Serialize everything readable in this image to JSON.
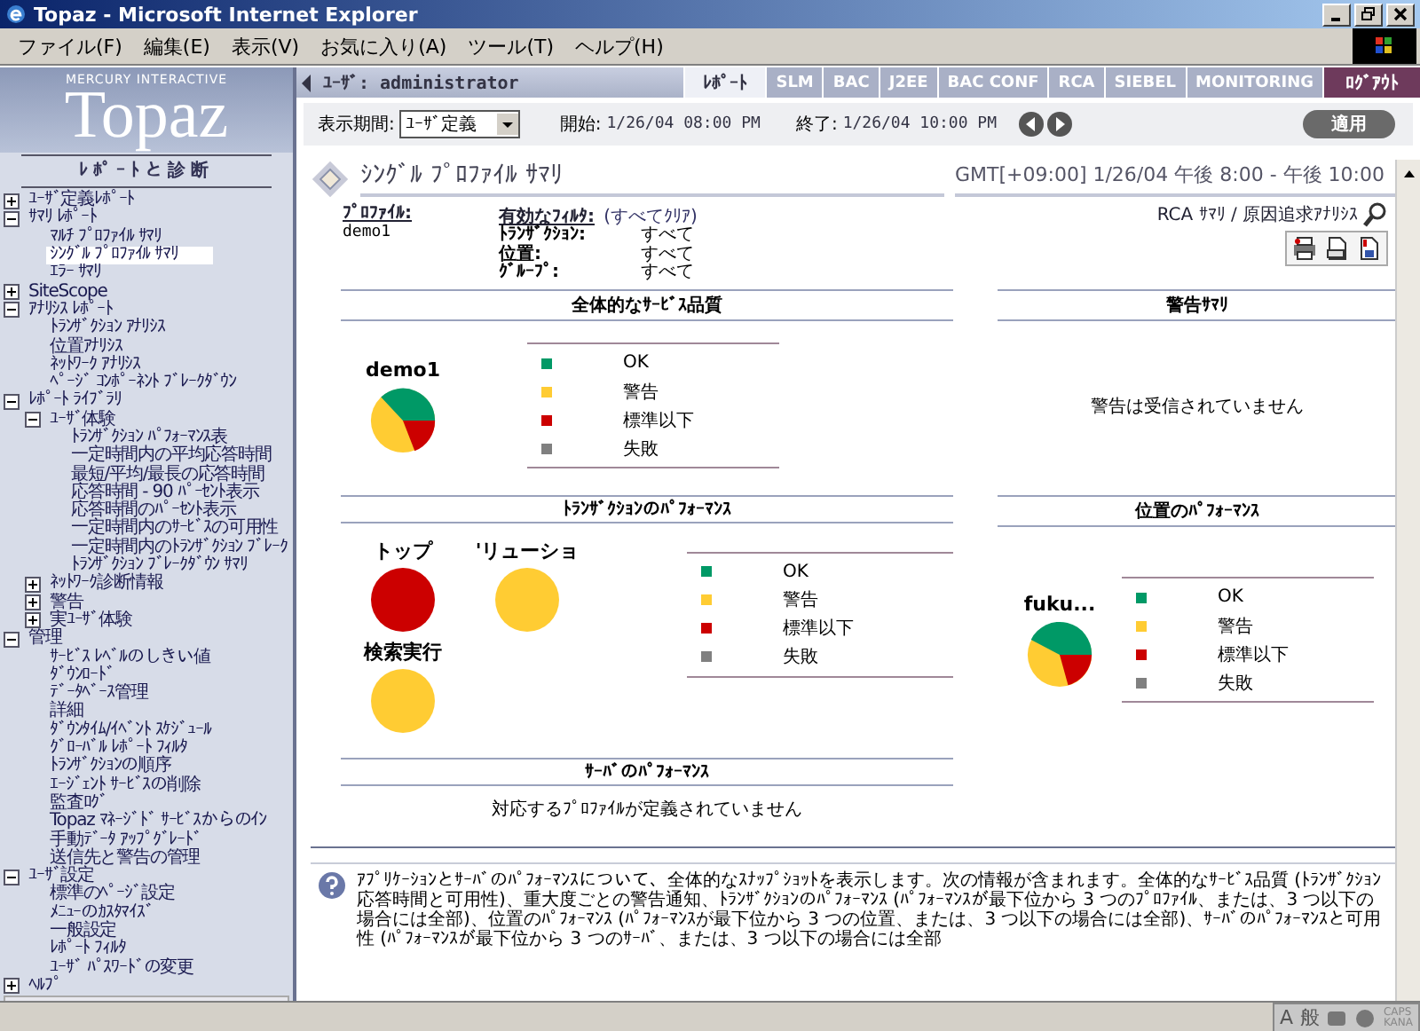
{
  "window": {
    "title": "Topaz - Microsoft Internet Explorer"
  },
  "menu": [
    "ファイル(F)",
    "編集(E)",
    "表示(V)",
    "お気に入り(A)",
    "ツール(T)",
    "ヘルプ(H)"
  ],
  "logo": {
    "company": "MERCURY INTERACTIVE",
    "product": "Topaz",
    "subtitle": "ﾚﾎﾟｰﾄと診断"
  },
  "user": "ﾕｰｻﾞ: administrator",
  "tabs": [
    {
      "label": "ﾚﾎﾟｰﾄ",
      "selected": true,
      "kind": "tab"
    },
    {
      "label": "SLM",
      "selected": false,
      "kind": "tab"
    },
    {
      "label": "BAC",
      "selected": false,
      "kind": "tab"
    },
    {
      "label": "J2EE",
      "selected": false,
      "kind": "tab"
    },
    {
      "label": "BAC CONF",
      "selected": false,
      "kind": "tab"
    },
    {
      "label": "RCA",
      "selected": false,
      "kind": "tab"
    },
    {
      "label": "SIEBEL",
      "selected": false,
      "kind": "tab"
    },
    {
      "label": "MONITORING",
      "selected": false,
      "kind": "tab"
    },
    {
      "label": "ﾛｸﾞｱｳﾄ",
      "selected": false,
      "kind": "logout"
    }
  ],
  "filter_bar": {
    "period_label": "表示期間:",
    "period_value": "ﾕｰｻﾞ定義",
    "start_label": "開始:",
    "start_value": "1/26/04 08:00 PM",
    "end_label": "終了:",
    "end_value": "1/26/04 10:00 PM",
    "apply": "適用"
  },
  "sidebar": {
    "items": [
      {
        "label": "ﾕｰｻﾞ定義ﾚﾎﾟｰﾄ",
        "expanded": false,
        "selected": false
      },
      {
        "label": "ｻﾏﾘ ﾚﾎﾟｰﾄ",
        "expanded": true,
        "selected": false,
        "children": [
          {
            "label": "ﾏﾙﾁ ﾌﾟﾛﾌｧｲﾙ ｻﾏﾘ",
            "selected": false
          },
          {
            "label": "ｼﾝｸﾞﾙ ﾌﾟﾛﾌｧｲﾙ ｻﾏﾘ",
            "selected": true
          },
          {
            "label": "ｴﾗｰ ｻﾏﾘ",
            "selected": false
          }
        ]
      },
      {
        "label": "SiteScope",
        "expanded": false,
        "selected": false
      },
      {
        "label": "ｱﾅﾘｼｽ ﾚﾎﾟｰﾄ",
        "expanded": true,
        "selected": false,
        "children": [
          {
            "label": "ﾄﾗﾝｻﾞｸｼｮﾝ ｱﾅﾘｼｽ",
            "selected": false
          },
          {
            "label": "位置ｱﾅﾘｼｽ",
            "selected": false
          },
          {
            "label": "ﾈｯﾄﾜｰｸ ｱﾅﾘｼｽ",
            "selected": false
          },
          {
            "label": "ﾍﾟｰｼﾞ ｺﾝﾎﾟｰﾈﾝﾄ ﾌﾞﾚｰｸﾀﾞｳﾝ",
            "selected": false
          }
        ]
      },
      {
        "label": "ﾚﾎﾟｰﾄ ﾗｲﾌﾞﾗﾘ",
        "expanded": true,
        "selected": false,
        "children": [
          {
            "label": "ﾕｰｻﾞ体験",
            "expanded": true,
            "selected": false,
            "children": [
              {
                "label": "ﾄﾗﾝｻﾞｸｼｮﾝ ﾊﾟﾌｫｰﾏﾝｽ表",
                "selected": false
              },
              {
                "label": "一定時間内の平均応答時間",
                "selected": false
              },
              {
                "label": "最短/平均/最長の応答時間",
                "selected": false
              },
              {
                "label": "応答時間 - 90 ﾊﾟｰｾﾝﾄ表示",
                "selected": false
              },
              {
                "label": "応答時間のﾊﾟｰｾﾝﾄ表示",
                "selected": false
              },
              {
                "label": "一定時間内のｻｰﾋﾞｽの可用性",
                "selected": false
              },
              {
                "label": "一定時間内のﾄﾗﾝｻﾞｸｼｮﾝ ﾌﾞﾚｰｸ",
                "selected": false
              },
              {
                "label": "ﾄﾗﾝｻﾞｸｼｮﾝ ﾌﾞﾚｰｸﾀﾞｳﾝ ｻﾏﾘ",
                "selected": false
              }
            ]
          },
          {
            "label": "ﾈｯﾄﾜｰｸ診断情報",
            "expanded": false,
            "selected": false
          },
          {
            "label": "警告",
            "expanded": false,
            "selected": false
          },
          {
            "label": "実ﾕｰｻﾞ体験",
            "expanded": false,
            "selected": false
          }
        ]
      },
      {
        "label": "管理",
        "expanded": true,
        "selected": false,
        "children": [
          {
            "label": "ｻｰﾋﾞｽ ﾚﾍﾞﾙのしきい値",
            "selected": false
          },
          {
            "label": "ﾀﾞｳﾝﾛｰﾄﾞ",
            "selected": false
          },
          {
            "label": "ﾃﾞｰﾀﾍﾞｰｽ管理",
            "selected": false
          },
          {
            "label": "詳細",
            "selected": false
          },
          {
            "label": "ﾀﾞｳﾝﾀｲﾑ/ｲﾍﾞﾝﾄ ｽｹｼﾞｭｰﾙ",
            "selected": false
          },
          {
            "label": "ｸﾞﾛｰﾊﾞﾙ ﾚﾎﾟｰﾄ ﾌｨﾙﾀ",
            "selected": false
          },
          {
            "label": "ﾄﾗﾝｻﾞｸｼｮﾝの順序",
            "selected": false
          },
          {
            "label": "ｴｰｼﾞｪﾝﾄ ｻｰﾋﾞｽの削除",
            "selected": false
          },
          {
            "label": "監査ﾛｸﾞ",
            "selected": false
          },
          {
            "label": "Topaz ﾏﾈｰｼﾞﾄﾞ ｻｰﾋﾞｽからのｲﾝ",
            "selected": false
          },
          {
            "label": "手動ﾃﾞｰﾀ ｱｯﾌﾟｸﾞﾚｰﾄﾞ",
            "selected": false
          },
          {
            "label": "送信先と警告の管理",
            "selected": false
          }
        ]
      },
      {
        "label": "ﾕｰｻﾞ設定",
        "expanded": true,
        "selected": false,
        "children": [
          {
            "label": "標準のﾍﾟｰｼﾞ設定",
            "selected": false
          },
          {
            "label": "ﾒﾆｭｰのｶｽﾀﾏｲｽﾞ",
            "selected": false
          },
          {
            "label": "一般設定",
            "selected": false
          },
          {
            "label": "ﾚﾎﾟｰﾄ ﾌｨﾙﾀ",
            "selected": false
          },
          {
            "label": "ﾕｰｻﾞ ﾊﾟｽﾜｰﾄﾞの変更",
            "selected": false
          }
        ]
      },
      {
        "label": "ﾍﾙﾌﾟ",
        "expanded": false,
        "selected": false
      }
    ]
  },
  "page": {
    "title": "ｼﾝｸﾞﾙ ﾌﾟﾛﾌｧｲﾙ ｻﾏﾘ",
    "time_range": "GMT[+09:00]  1/26/04 午後 8:00 - 午後 10:00"
  },
  "profile": {
    "label": "ﾌﾟﾛﾌｧｲﾙ:",
    "value": "demo1"
  },
  "filters": {
    "label": "有効なﾌｨﾙﾀ:",
    "clear": "(すべてｸﾘｱ)",
    "rows": [
      {
        "name": "ﾄﾗﾝｻﾞｸｼｮﾝ:",
        "value": "すべて"
      },
      {
        "name": "位置:",
        "value": "すべて"
      },
      {
        "name": "ｸﾞﾙｰﾌﾟ:",
        "value": "すべて"
      }
    ]
  },
  "rca_link": "RCA ｻﾏﾘ / 原因追求ｱﾅﾘｼｽ",
  "overall": {
    "title": "全体的なｻｰﾋﾞｽ品質",
    "profile": "demo1",
    "legend": [
      {
        "label": "OK",
        "color": "#009966"
      },
      {
        "label": "警告",
        "color": "#ffcc33"
      },
      {
        "label": "標準以下",
        "color": "#cc0000"
      },
      {
        "label": "失敗",
        "color": "#808080"
      }
    ]
  },
  "alerts": {
    "title": "警告ｻﾏﾘ",
    "message": "警告は受信されていません"
  },
  "transactions": {
    "title": "ﾄﾗﾝｻﾞｸｼｮﾝのﾊﾟﾌｫｰﾏﾝｽ",
    "items": [
      {
        "name": "トップ",
        "color": "#cc0000"
      },
      {
        "name": "'リューショ",
        "color": "#ffcc33"
      },
      {
        "name": "検索実行",
        "color": "#ffcc33"
      }
    ],
    "legend": [
      {
        "label": "OK",
        "color": "#009966"
      },
      {
        "label": "警告",
        "color": "#ffcc33"
      },
      {
        "label": "標準以下",
        "color": "#cc0000"
      },
      {
        "label": "失敗",
        "color": "#808080"
      }
    ]
  },
  "locations": {
    "title": "位置のﾊﾟﾌｫｰﾏﾝｽ",
    "location": "fuku...",
    "legend": [
      {
        "label": "OK",
        "color": "#009966"
      },
      {
        "label": "警告",
        "color": "#ffcc33"
      },
      {
        "label": "標準以下",
        "color": "#cc0000"
      },
      {
        "label": "失敗",
        "color": "#808080"
      }
    ]
  },
  "servers": {
    "title": "ｻｰﾊﾞのﾊﾟﾌｫｰﾏﾝｽ",
    "message": "対応するﾌﾟﾛﾌｧｲﾙが定義されていません"
  },
  "help_text": "ｱﾌﾟﾘｹｰｼｮﾝとｻｰﾊﾞのﾊﾟﾌｫｰﾏﾝｽについて、全体的なｽﾅｯﾌﾟｼｮｯﾄを表示します。次の情報が含まれます。全体的なｻｰﾋﾞｽ品質 (ﾄﾗﾝｻﾞｸｼｮﾝ応答時間と可用性)、重大度ごとの警告通知、ﾄﾗﾝｻﾞｸｼｮﾝのﾊﾟﾌｫｰﾏﾝｽ (ﾊﾟﾌｫｰﾏﾝｽが最下位から 3 つのﾌﾟﾛﾌｧｲﾙ、または、3 つ以下の場合には全部)、位置のﾊﾟﾌｫｰﾏﾝｽ (ﾊﾟﾌｫｰﾏﾝｽが最下位から 3 つの位置、または、3 つ以下の場合には全部)、ｻｰﾊﾞのﾊﾟﾌｫｰﾏﾝｽと可用性 (ﾊﾟﾌｫｰﾏﾝｽが最下位から 3 つのｻｰﾊﾞ、または、3 つ以下の場合には全部",
  "ime_bar": {
    "modes": [
      "A",
      "般"
    ],
    "indicators": [
      "CAPS",
      "KANA"
    ]
  }
}
